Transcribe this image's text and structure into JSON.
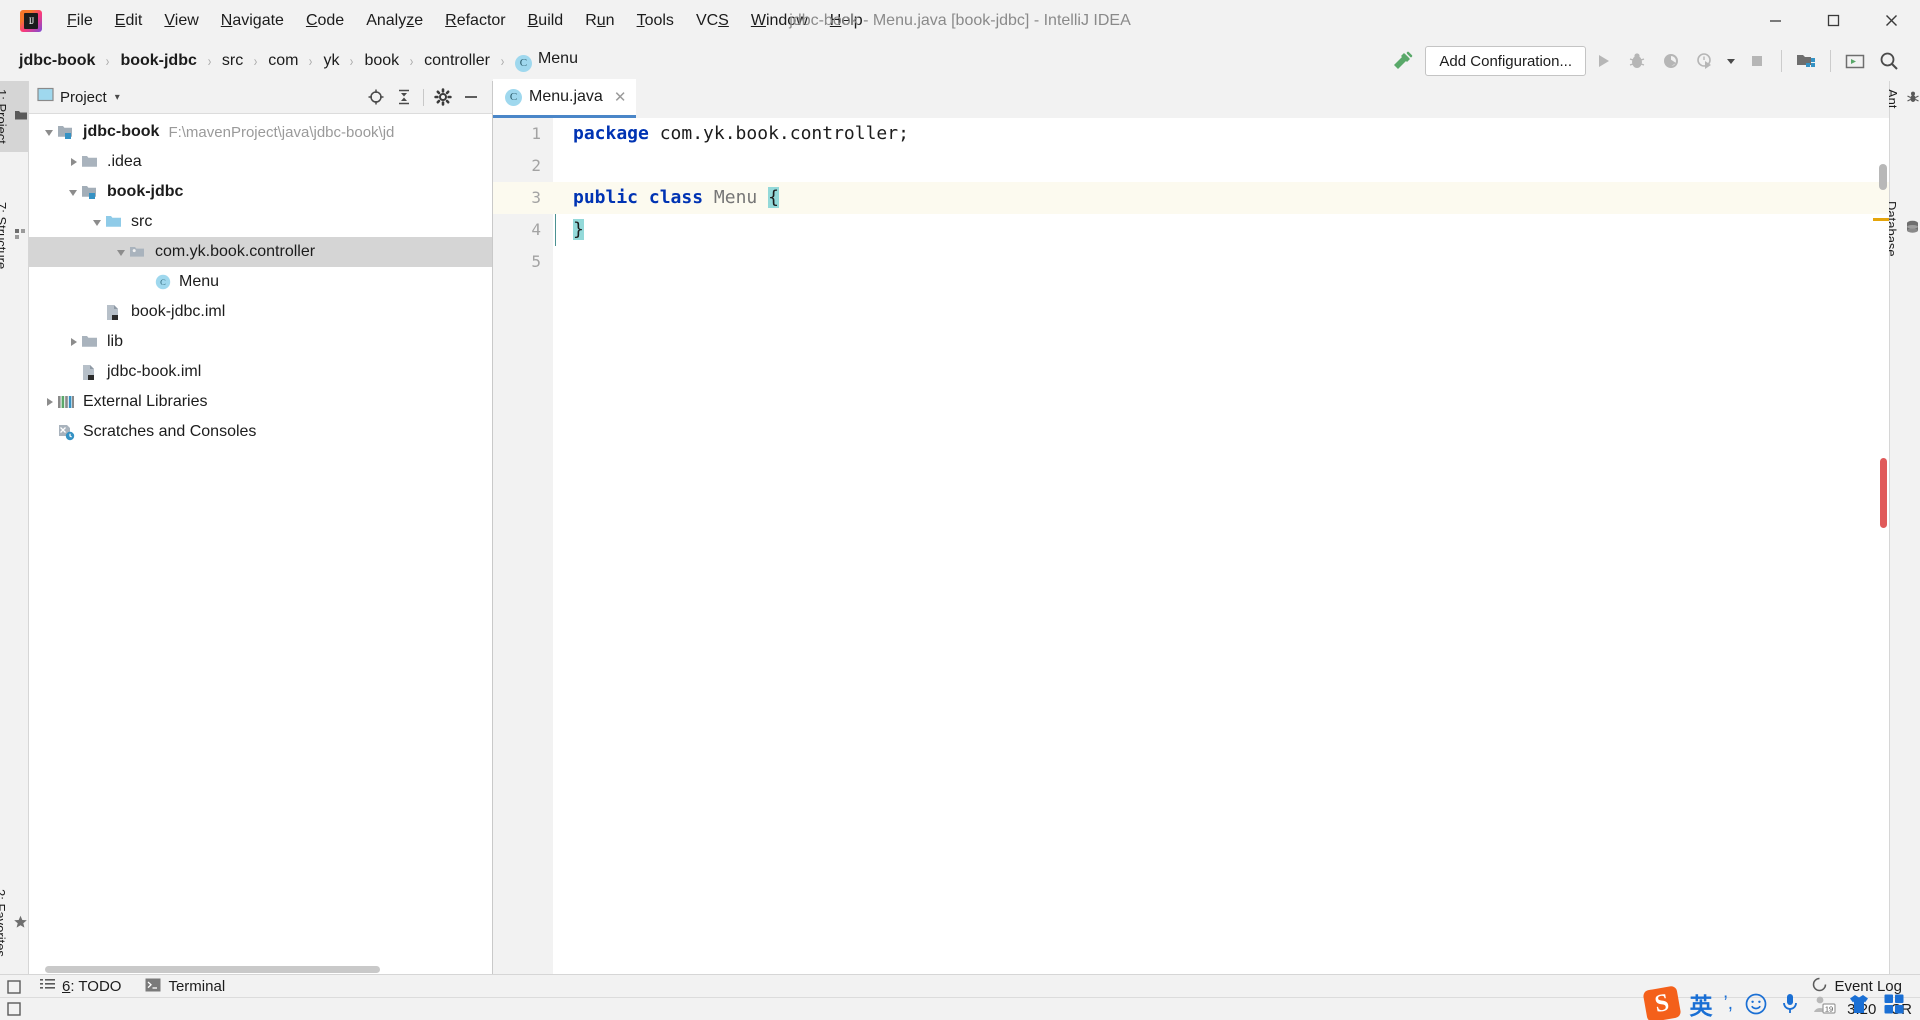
{
  "window": {
    "title": "jdbc-book - Menu.java [book-jdbc] - IntelliJ IDEA",
    "logo_text": "IJ",
    "minimize": "─",
    "maximize": "□",
    "close": "✕"
  },
  "menubar": {
    "items": [
      {
        "name": "file",
        "pre": "",
        "mn": "F",
        "post": "ile"
      },
      {
        "name": "edit",
        "pre": "",
        "mn": "E",
        "post": "dit"
      },
      {
        "name": "view",
        "pre": "",
        "mn": "V",
        "post": "iew"
      },
      {
        "name": "navigate",
        "pre": "",
        "mn": "N",
        "post": "avigate"
      },
      {
        "name": "code",
        "pre": "",
        "mn": "C",
        "post": "ode"
      },
      {
        "name": "analyze",
        "pre": "Analy",
        "mn": "z",
        "post": "e"
      },
      {
        "name": "refactor",
        "pre": "",
        "mn": "R",
        "post": "efactor"
      },
      {
        "name": "build",
        "pre": "",
        "mn": "B",
        "post": "uild"
      },
      {
        "name": "run",
        "pre": "R",
        "mn": "u",
        "post": "n"
      },
      {
        "name": "tools",
        "pre": "",
        "mn": "T",
        "post": "ools"
      },
      {
        "name": "vcs",
        "pre": "VC",
        "mn": "S",
        "post": ""
      },
      {
        "name": "window",
        "pre": "",
        "mn": "W",
        "post": "indow"
      },
      {
        "name": "help",
        "pre": "",
        "mn": "H",
        "post": "elp"
      }
    ]
  },
  "breadcrumb": {
    "separator": "›",
    "items": [
      {
        "label": "jdbc-book",
        "bold": true,
        "icon": null
      },
      {
        "label": "book-jdbc",
        "bold": true,
        "icon": null
      },
      {
        "label": "src",
        "bold": false,
        "icon": null
      },
      {
        "label": "com",
        "bold": false,
        "icon": null
      },
      {
        "label": "yk",
        "bold": false,
        "icon": null
      },
      {
        "label": "book",
        "bold": false,
        "icon": null
      },
      {
        "label": "controller",
        "bold": false,
        "icon": null
      },
      {
        "label": "Menu",
        "bold": false,
        "icon": "class-badge",
        "badge": "C"
      }
    ]
  },
  "toolbar": {
    "build_icon": "hammer-icon",
    "add_configuration": "Add Configuration...",
    "icons": [
      {
        "name": "run-icon"
      },
      {
        "name": "debug-icon"
      },
      {
        "name": "run-with-coverage-icon"
      },
      {
        "name": "profile-icon"
      },
      {
        "name": "profile-dropdown-icon"
      },
      {
        "name": "stop-icon"
      },
      {
        "name": "project-structure-icon"
      },
      {
        "name": "console-icon"
      },
      {
        "name": "search-everywhere-icon"
      }
    ]
  },
  "left_stripe": {
    "project": {
      "num": "1",
      "label": ": Project",
      "active": true,
      "icon": "project-folder-icon"
    },
    "structure": {
      "num": "7",
      "label": ": Structure",
      "active": false,
      "icon": "structure-icon"
    },
    "favorites": {
      "num": "2",
      "label": ": Favorites",
      "active": false,
      "icon": "star-icon"
    }
  },
  "right_stripe": {
    "ant": {
      "label": "Ant",
      "icon": "ant-icon"
    },
    "database": {
      "label": "Database",
      "icon": "database-icon"
    }
  },
  "project_panel": {
    "title": "Project",
    "caret": "▾",
    "actions": [
      {
        "name": "select-opened-file-icon"
      },
      {
        "name": "collapse-all-icon"
      },
      {
        "name": "settings-gear-icon"
      },
      {
        "name": "hide-panel-icon"
      }
    ],
    "tree": [
      {
        "name": "jdbc-book",
        "label": "jdbc-book",
        "path": "F:\\mavenProject\\java\\jdbc-book\\jd",
        "indent": 0,
        "arrow": "down",
        "icon": "module-root-icon",
        "bold": true,
        "selected": false
      },
      {
        "name": "idea-folder",
        "label": ".idea",
        "path": "",
        "indent": 1,
        "arrow": "right",
        "icon": "folder-icon",
        "bold": false,
        "selected": false
      },
      {
        "name": "book-jdbc-module",
        "label": "book-jdbc",
        "path": "",
        "indent": 1,
        "arrow": "down",
        "icon": "module-root-icon",
        "bold": true,
        "selected": false
      },
      {
        "name": "src-folder",
        "label": "src",
        "path": "",
        "indent": 2,
        "arrow": "down",
        "icon": "source-folder-icon",
        "bold": false,
        "selected": false
      },
      {
        "name": "package-controller",
        "label": "com.yk.book.controller",
        "path": "",
        "indent": 3,
        "arrow": "down",
        "icon": "package-icon",
        "bold": false,
        "selected": true
      },
      {
        "name": "class-menu",
        "label": "Menu",
        "path": "",
        "indent": 4,
        "arrow": "none",
        "icon": "class-icon",
        "bold": false,
        "selected": false
      },
      {
        "name": "book-jdbc-iml",
        "label": "book-jdbc.iml",
        "path": "",
        "indent": 2,
        "arrow": "none",
        "icon": "iml-file-icon",
        "bold": false,
        "selected": false
      },
      {
        "name": "lib-folder",
        "label": "lib",
        "path": "",
        "indent": 1,
        "arrow": "right",
        "icon": "folder-icon",
        "bold": false,
        "selected": false
      },
      {
        "name": "jdbc-book-iml",
        "label": "jdbc-book.iml",
        "path": "",
        "indent": 1,
        "arrow": "none",
        "icon": "iml-file-icon",
        "bold": false,
        "selected": false
      },
      {
        "name": "external-libraries",
        "label": "External Libraries",
        "path": "",
        "indent": 0,
        "arrow": "right",
        "icon": "libraries-icon",
        "bold": false,
        "selected": false
      },
      {
        "name": "scratches-and-consoles",
        "label": "Scratches and Consoles",
        "path": "",
        "indent": 0,
        "arrow": "none",
        "icon": "scratches-icon",
        "bold": false,
        "selected": false
      }
    ]
  },
  "editor": {
    "tab": {
      "label": "Menu.java",
      "badge": "C",
      "close": "✕"
    },
    "lines": [
      {
        "num": "1",
        "current": false
      },
      {
        "num": "2",
        "current": false
      },
      {
        "num": "3",
        "current": true
      },
      {
        "num": "4",
        "current": false
      },
      {
        "num": "5",
        "current": false
      }
    ],
    "code": {
      "l1_kw": "package",
      "l1_rest": " com.yk.book.controller;",
      "l3_kw1": "public",
      "l3_kw2": "class",
      "l3_name": "Menu",
      "l3_brace": "{",
      "l4_brace": "}"
    }
  },
  "bottom_bar": {
    "todo": {
      "num": "6",
      "label": ": TODO",
      "icon": "todo-list-icon"
    },
    "terminal": {
      "label": "Terminal",
      "icon": "terminal-icon"
    },
    "event_log": {
      "label": "Event Log",
      "icon": "event-log-icon"
    }
  },
  "statusbar": {
    "caret_position": "3:20",
    "line_separator": "CR",
    "hide_icon": "hide-tool-windows-icon"
  },
  "ime": {
    "logo": "S",
    "mode": "英",
    "punctuation": "’,",
    "emoji": "☺",
    "voice": "voice-input-icon",
    "calendar": "19",
    "skin": "skin-icon",
    "toolbox": "toolbox-icon"
  },
  "colors": {
    "accent_blue": "#4a86c8",
    "keyword_blue": "#0033b3",
    "brace_highlight": "#93d9d9",
    "current_line": "#fcfaef",
    "selection_gray": "#d5d5d5",
    "panel_bg": "#f2f2f2"
  }
}
